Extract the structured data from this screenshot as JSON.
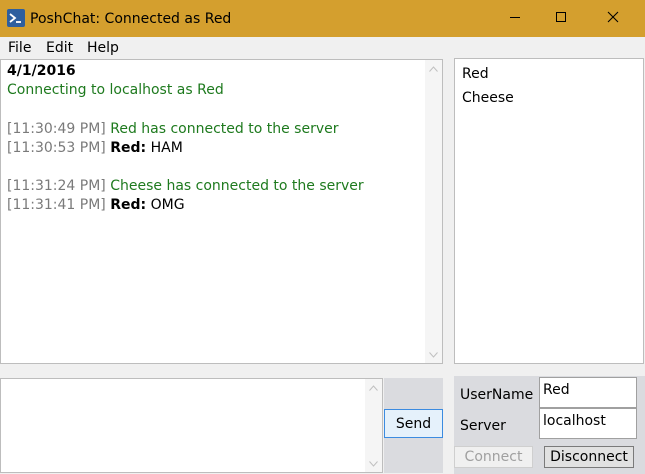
{
  "window": {
    "title": "PoshChat: Connected as Red"
  },
  "menu": {
    "items": [
      "File",
      "Edit",
      "Help"
    ]
  },
  "chat": {
    "date": "4/1/2016",
    "status": "Connecting to localhost as Red",
    "messages": [
      {
        "time": "[11:30:49 PM]",
        "text": "Red has connected to the server"
      },
      {
        "time": "[11:30:53 PM]",
        "sender": "Red:",
        "text": "HAM"
      },
      {
        "time": "[11:31:24 PM]",
        "text": "Cheese has connected to the server"
      },
      {
        "time": "[11:31:41 PM]",
        "sender": "Red:",
        "text": "OMG"
      }
    ]
  },
  "users": [
    "Red",
    "Cheese"
  ],
  "compose": {
    "send_label": "Send"
  },
  "settings": {
    "username_label": "UserName",
    "username_value": "Red",
    "server_label": "Server",
    "server_value": "localhost",
    "connect_label": "Connect",
    "disconnect_label": "Disconnect"
  },
  "colors": {
    "titlebar": "#d49f2e",
    "system_text": "#1e7a1e",
    "timestamp": "#7a7a7a",
    "send_border": "#3b8be0"
  }
}
